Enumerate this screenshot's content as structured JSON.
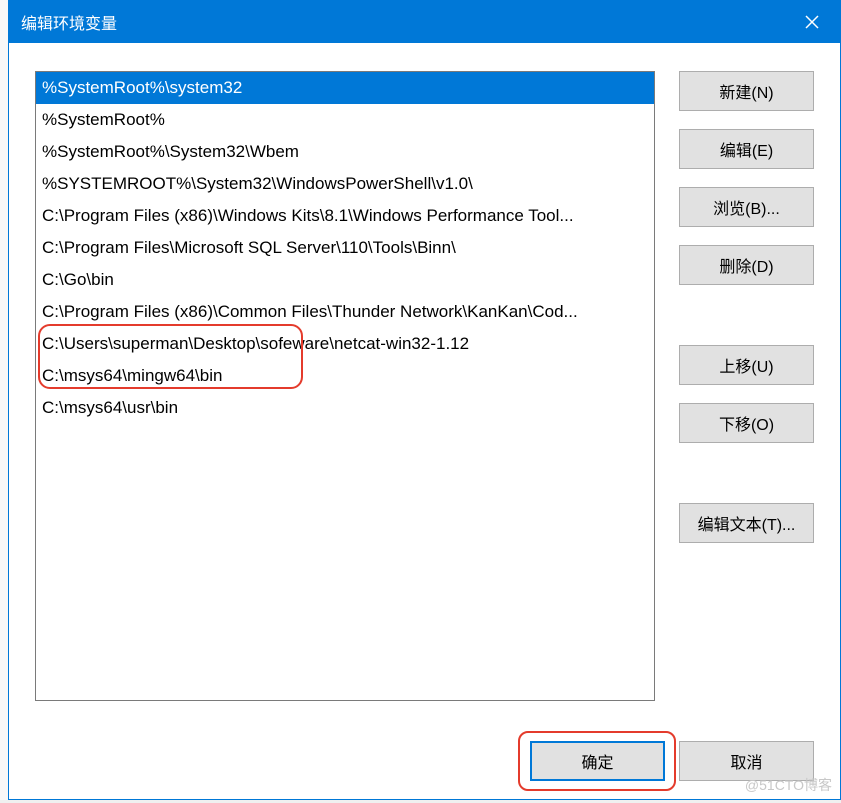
{
  "titlebar": {
    "title": "编辑环境变量"
  },
  "paths": [
    "%SystemRoot%\\system32",
    "%SystemRoot%",
    "%SystemRoot%\\System32\\Wbem",
    "%SYSTEMROOT%\\System32\\WindowsPowerShell\\v1.0\\",
    "C:\\Program Files (x86)\\Windows Kits\\8.1\\Windows Performance Tool...",
    "C:\\Program Files\\Microsoft SQL Server\\110\\Tools\\Binn\\",
    "C:\\Go\\bin",
    "C:\\Program Files (x86)\\Common Files\\Thunder Network\\KanKan\\Cod...",
    "C:\\Users\\superman\\Desktop\\sofeware\\netcat-win32-1.12",
    "C:\\msys64\\mingw64\\bin",
    "C:\\msys64\\usr\\bin"
  ],
  "selectedIndex": 0,
  "buttons": {
    "new": "新建(N)",
    "edit": "编辑(E)",
    "browse": "浏览(B)...",
    "delete": "删除(D)",
    "moveUp": "上移(U)",
    "moveDown": "下移(O)",
    "editText": "编辑文本(T)...",
    "ok": "确定",
    "cancel": "取消"
  },
  "watermark": "@51CTO博客"
}
